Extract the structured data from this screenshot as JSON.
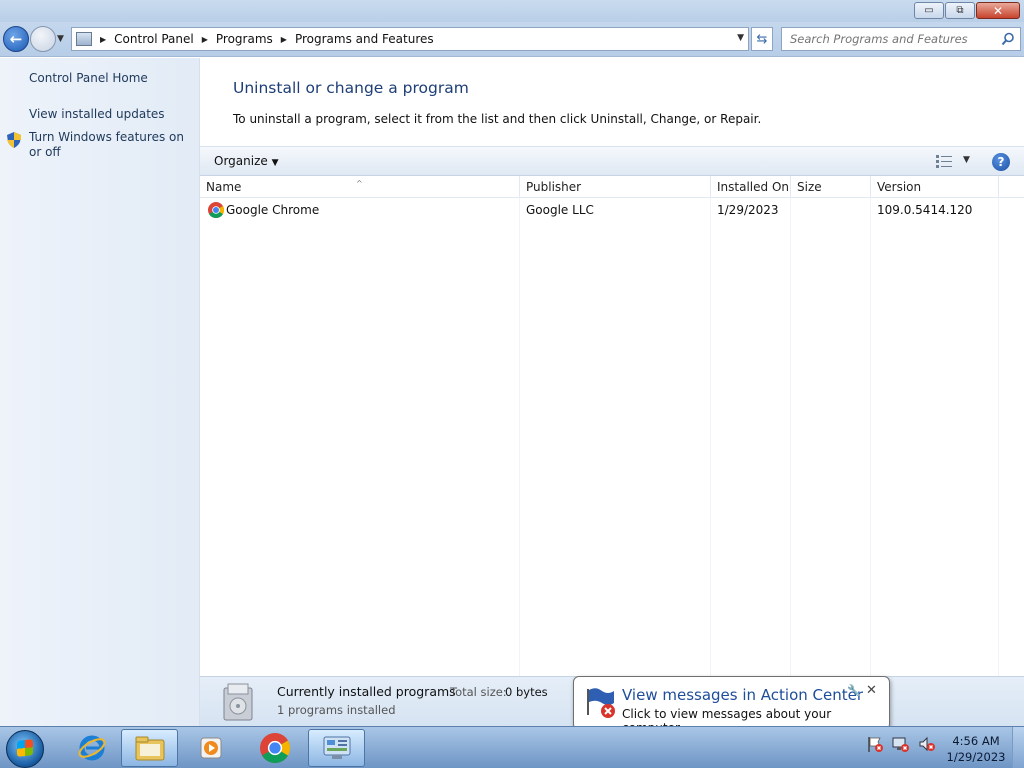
{
  "window": {
    "minimize_glyph": "▭",
    "maximize_glyph": "⧉",
    "close_glyph": "✕"
  },
  "address": {
    "breadcrumbs": [
      "Control Panel",
      "Programs",
      "Programs and Features"
    ],
    "search_placeholder": "Search Programs and Features"
  },
  "sidebar": {
    "items": [
      {
        "label": "Control Panel Home"
      },
      {
        "label": "View installed updates"
      },
      {
        "label": "Turn Windows features on or off"
      }
    ]
  },
  "main": {
    "title": "Uninstall or change a program",
    "description": "To uninstall a program, select it from the list and then click Uninstall, Change, or Repair.",
    "organize_label": "Organize",
    "columns": [
      "Name",
      "Publisher",
      "Installed On",
      "Size",
      "Version"
    ],
    "rows": [
      {
        "name": "Google Chrome",
        "publisher": "Google LLC",
        "installed_on": "1/29/2023",
        "size": "",
        "version": "109.0.5414.120"
      }
    ]
  },
  "details": {
    "title": "Currently installed programs",
    "total_size_label": "Total size:",
    "total_size_value": "0 bytes",
    "count": "1 programs installed"
  },
  "balloon": {
    "title": "View messages in Action Center",
    "text": "Click to view messages about your computer."
  },
  "taskbar": {
    "apps": [
      "internet-explorer",
      "windows-explorer",
      "windows-media-player",
      "google-chrome",
      "control-panel"
    ],
    "time": "4:56 AM",
    "date": "1/29/2023"
  },
  "colors": {
    "accent": "#1e3e76",
    "link": "#1e395b",
    "taskbar": "#6e95c5"
  }
}
